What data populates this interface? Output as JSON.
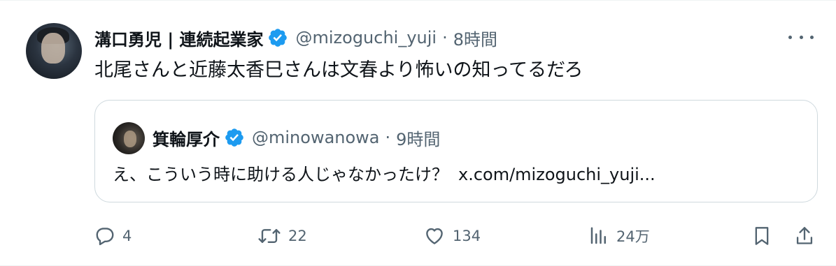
{
  "tweet": {
    "author_name": "溝口勇児 | 連続起業家",
    "handle": "@mizoguchi_yuji",
    "separator": "·",
    "time": "8時間",
    "text": "北尾さんと近藤太香巳さんは文春より怖いの知ってるだろ",
    "verified_color": "#1d9bf0"
  },
  "quote": {
    "author_name": "箕輪厚介",
    "handle": "@minowanowa",
    "separator": "·",
    "time": "9時間",
    "text": "え、こういう時に助ける人じゃなかったけ？",
    "link": "x.com/mizoguchi_yuji..."
  },
  "actions": {
    "reply_count": "4",
    "retweet_count": "22",
    "like_count": "134",
    "views_count": "24万"
  },
  "icons": {
    "more": "more-icon",
    "reply": "reply-icon",
    "retweet": "retweet-icon",
    "like": "like-icon",
    "views": "views-icon",
    "bookmark": "bookmark-icon",
    "share": "share-icon"
  }
}
